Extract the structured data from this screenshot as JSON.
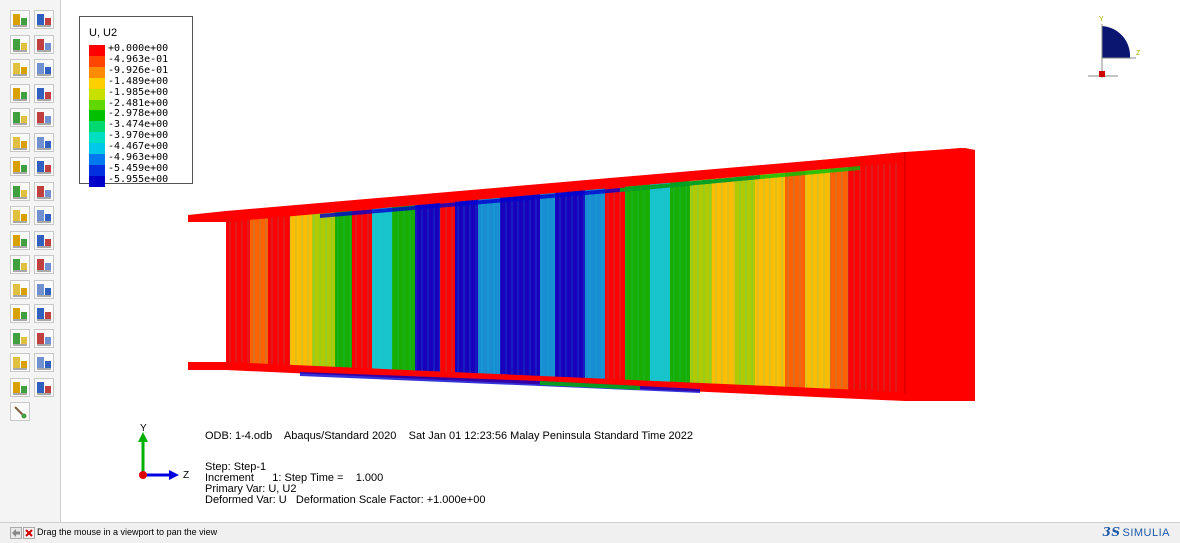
{
  "legend": {
    "title": "U, U2",
    "entries": [
      {
        "label": "+0.000e+00",
        "color": "#ff0000"
      },
      {
        "label": "-4.963e-01",
        "color": "#ff4500"
      },
      {
        "label": "-9.926e-01",
        "color": "#ff8c00"
      },
      {
        "label": "-1.489e+00",
        "color": "#ffd000"
      },
      {
        "label": "-1.985e+00",
        "color": "#c8e000"
      },
      {
        "label": "-2.481e+00",
        "color": "#60d800"
      },
      {
        "label": "-2.978e+00",
        "color": "#00c000"
      },
      {
        "label": "-3.474e+00",
        "color": "#00d870"
      },
      {
        "label": "-3.970e+00",
        "color": "#00e0c0"
      },
      {
        "label": "-4.467e+00",
        "color": "#00c8e8"
      },
      {
        "label": "-4.963e+00",
        "color": "#0078f0"
      },
      {
        "label": "-5.459e+00",
        "color": "#0030e0"
      },
      {
        "label": "-5.955e+00",
        "color": "#0000c8"
      }
    ]
  },
  "triad": {
    "y": "Y",
    "z": "Z"
  },
  "mini_triad": {
    "y": "Y",
    "z": "Z"
  },
  "info": {
    "odb": "ODB: 1-4.odb    Abaqus/Standard 2020    Sat Jan 01 12:23:56 Malay Peninsula Standard Time 2022",
    "step": "Step: Step-1",
    "increment": "Increment      1: Step Time =    1.000",
    "primary": "Primary Var: U, U2",
    "deformed": "Deformed Var: U   Deformation Scale Factor: +1.000e+00"
  },
  "status": {
    "text": "Drag the mouse in a viewport to pan the view"
  },
  "brand": {
    "mark": "3S",
    "name": "SIMULIA"
  },
  "toolbox": {
    "icons": [
      "plot-undeformed-icon",
      "plot-deformed-icon",
      "plot-contours-icon",
      "plot-contours-options-icon",
      "plot-symbols-icon",
      "plot-symbols-options-icon",
      "plot-material-orientations-icon",
      "material-orientation-options-icon",
      "allow-multiple-plot-states-icon",
      "superimpose-options-icon",
      "animate-time-history-icon",
      "animation-options-icon",
      "view-cut-icon",
      "view-cut-manager-icon",
      "free-body-cut-icon",
      "free-body-manager-icon",
      "xy-data-icon",
      "xy-data-manager-icon",
      "create-path-icon",
      "create-xy-plot-icon",
      "stream-plot-icon",
      "stream-manager-icon",
      "report-field-output-icon",
      "report-options-icon",
      "probe-values-icon",
      "probe-options-icon",
      "display-group-icon",
      "display-group-manager-icon",
      "create-display-group-icon",
      "replace-display-group-icon",
      "query-information-icon",
      "query-options-icon"
    ],
    "last_icon": "paint-brush-icon"
  },
  "colors": {
    "red": "#ff0000",
    "orange": "#ff6a00",
    "yellow": "#ffd000",
    "lime": "#a8e000",
    "green": "#00c000",
    "cyan": "#00d8e0",
    "skyblue": "#009ce8",
    "blue": "#0000d0",
    "darkred": "#c80000"
  }
}
